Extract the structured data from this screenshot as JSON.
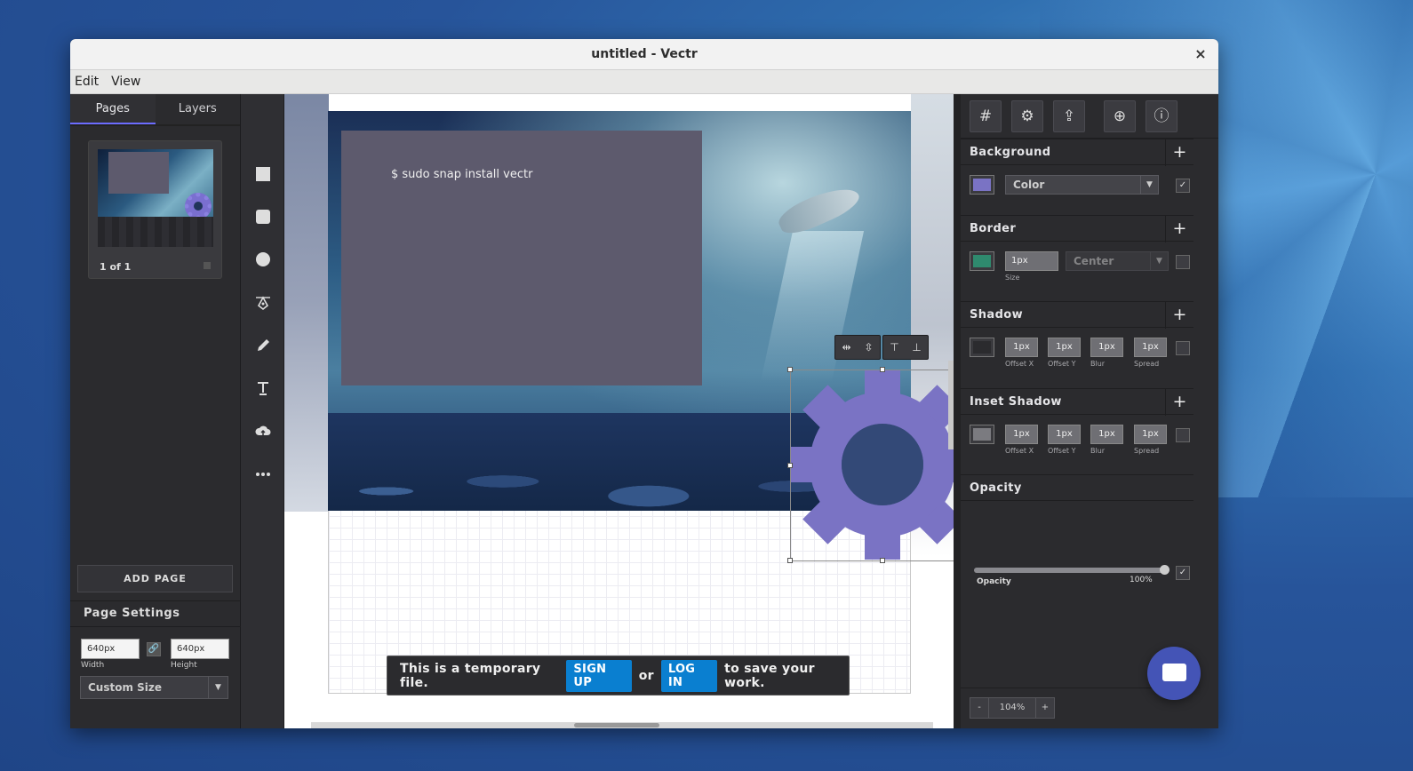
{
  "window": {
    "title": "untitled - Vectr",
    "close_label": "×"
  },
  "menu": [
    "Edit",
    "View"
  ],
  "left": {
    "tabs": [
      "Pages",
      "Layers"
    ],
    "page_caption": "1 of 1",
    "add_page": "ADD PAGE",
    "settings_title": "Page Settings",
    "width_value": "640px",
    "height_value": "640px",
    "width_label": "Width",
    "height_label": "Height",
    "size_select": "Custom Size"
  },
  "tools": [
    "rectangle-tool",
    "rounded-rectangle-tool",
    "ellipse-tool",
    "pen-tool",
    "pencil-tool",
    "text-tool",
    "upload-tool",
    "more-tools"
  ],
  "canvas": {
    "command_text": "$ sudo snap install vectr",
    "toast_text_before": "This is a temporary file.",
    "signup": "SIGN UP",
    "or": "or",
    "login": "LOG IN",
    "toast_text_after": "to save your work."
  },
  "right": {
    "background": {
      "title": "Background",
      "color": "#7a73c4",
      "type": "Color"
    },
    "border": {
      "title": "Border",
      "color": "#2f8a6e",
      "size": "1px",
      "size_label": "Size",
      "position": "Center"
    },
    "shadow": {
      "title": "Shadow",
      "color": "#2b2b2e",
      "values": [
        "1px",
        "1px",
        "1px",
        "1px"
      ],
      "labels": [
        "Offset X",
        "Offset Y",
        "Blur",
        "Spread"
      ]
    },
    "inset_shadow": {
      "title": "Inset Shadow",
      "color": "#7b7b80",
      "values": [
        "1px",
        "1px",
        "1px",
        "1px"
      ],
      "labels": [
        "Offset X",
        "Offset Y",
        "Blur",
        "Spread"
      ]
    },
    "opacity": {
      "title": "Opacity",
      "label": "Opacity",
      "value_text": "100%",
      "value": 1.0
    },
    "zoom": {
      "minus": "-",
      "value": "104%",
      "plus": "+"
    }
  },
  "colors": {
    "accent": "#0a7fd0",
    "gear": "#7a73c4",
    "chat": "#4454b6"
  }
}
